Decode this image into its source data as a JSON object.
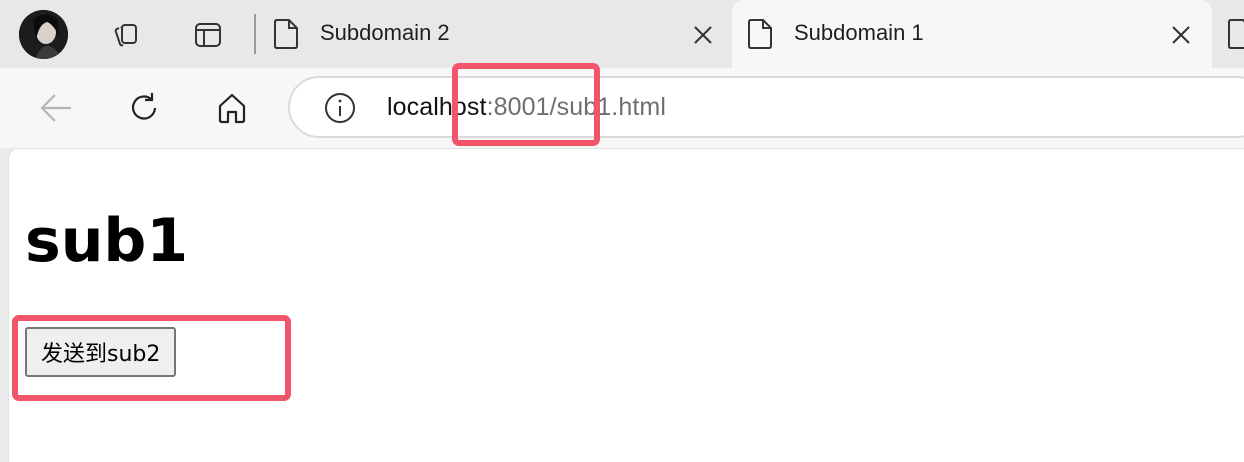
{
  "tabs": [
    {
      "title": "Subdomain 2",
      "active": false
    },
    {
      "title": "Subdomain 1",
      "active": true
    }
  ],
  "address_bar": {
    "host": "localhost",
    "rest": ":8001/sub1.html"
  },
  "page": {
    "heading": "sub1",
    "button_label": "发送到sub2"
  },
  "icons": {
    "avatar": "user-avatar",
    "workspaces": "workspaces-icon",
    "vertical_tabs": "tab-actions-icon",
    "file": "page-icon",
    "close": "close-icon",
    "back": "back-arrow-icon",
    "reload": "refresh-icon",
    "home": "home-icon",
    "site_info": "info-icon"
  },
  "colors": {
    "annotation": "#f2546a",
    "tab_strip": "#e8e8e8",
    "active_tab": "#f7f7f7"
  }
}
